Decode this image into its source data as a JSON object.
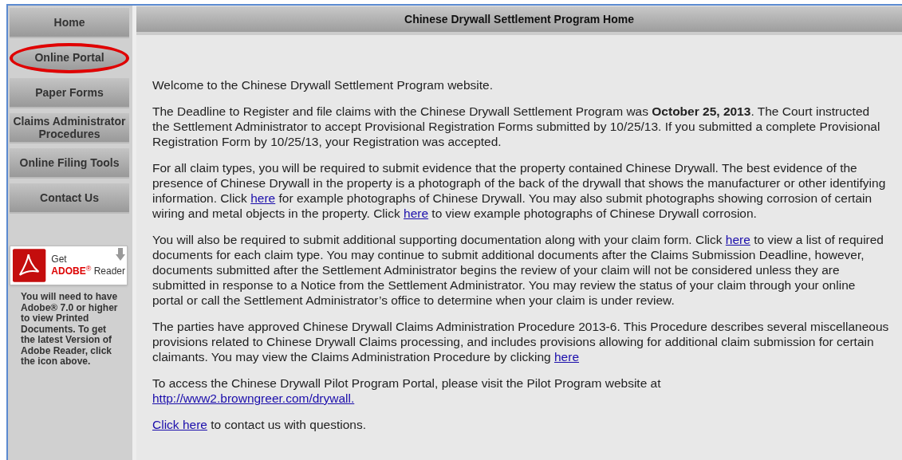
{
  "nav": [
    {
      "label": "Home",
      "circled": false
    },
    {
      "label": "Online Portal",
      "circled": true
    },
    {
      "label": "Paper Forms",
      "circled": false
    },
    {
      "label": "Claims Administrator Procedures",
      "circled": false
    },
    {
      "label": "Online Filing Tools",
      "circled": false
    },
    {
      "label": "Contact Us",
      "circled": false
    }
  ],
  "adobe_badge": {
    "line1": "Get",
    "brand": "ADOBE",
    "mark": "®",
    "product": "Reader"
  },
  "adobe_note": "You will need to have Adobe® 7.0 or higher to view Printed Documents. To get the latest Version of Adobe Reader, click the icon above.",
  "header": {
    "title": "Chinese Drywall Settlement Program Home"
  },
  "paragraphs": [
    [
      {
        "kind": "text",
        "text": "Welcome to the Chinese Drywall Settlement Program website."
      }
    ],
    [
      {
        "kind": "text",
        "text": "The Deadline to Register and file claims with the Chinese Drywall Settlement Program was "
      },
      {
        "kind": "bold",
        "text": "October 25, 2013"
      },
      {
        "kind": "text",
        "text": ". The Court instructed the Settlement Administrator to accept Provisional Registration Forms submitted by 10/25/13. If you submitted a complete Provisional Registration Form by 10/25/13, your Registration was accepted."
      }
    ],
    [
      {
        "kind": "text",
        "text": "For all claim types, you will be required to submit evidence that the property contained Chinese Drywall. The best evidence of the presence of Chinese Drywall in the property is a photograph of the back of the drywall that shows the manufacturer or other identifying information. Click "
      },
      {
        "kind": "link",
        "text": "here"
      },
      {
        "kind": "text",
        "text": " for example photographs of Chinese Drywall. You may also submit photographs showing corrosion of certain wiring and metal objects in the property. Click "
      },
      {
        "kind": "link",
        "text": "here"
      },
      {
        "kind": "text",
        "text": " to view example photographs of Chinese Drywall corrosion."
      }
    ],
    [
      {
        "kind": "text",
        "text": "You will also be required to submit additional supporting documentation along with your claim form. Click "
      },
      {
        "kind": "link",
        "text": "here"
      },
      {
        "kind": "text",
        "text": " to view a list of required documents for each claim type. You may continue to submit additional documents after the Claims Submission Deadline, however, documents submitted after the Settlement Administrator begins the review of your claim will not be considered unless they are submitted in response to a Notice from the Settlement Administrator. You may review the status of your claim through your online portal or call the Settlement Administrator’s office to determine when your claim is under review."
      }
    ],
    [
      {
        "kind": "text",
        "text": "The parties have approved Chinese Drywall Claims Administration Procedure 2013-6. This Procedure describes several miscellaneous provisions related to Chinese Drywall Claims processing, and includes provisions allowing for additional claim submission for certain claimants. You may view the Claims Administration Procedure by clicking "
      },
      {
        "kind": "link",
        "text": "here"
      }
    ],
    [
      {
        "kind": "text",
        "text": "To access the Chinese Drywall Pilot Program Portal, please visit the Pilot Program website at "
      },
      {
        "kind": "break"
      },
      {
        "kind": "link",
        "text": "http://www2.browngreer.com/drywall."
      }
    ],
    [
      {
        "kind": "link",
        "text": "Click here"
      },
      {
        "kind": "text",
        "text": " to contact us with questions."
      }
    ]
  ]
}
